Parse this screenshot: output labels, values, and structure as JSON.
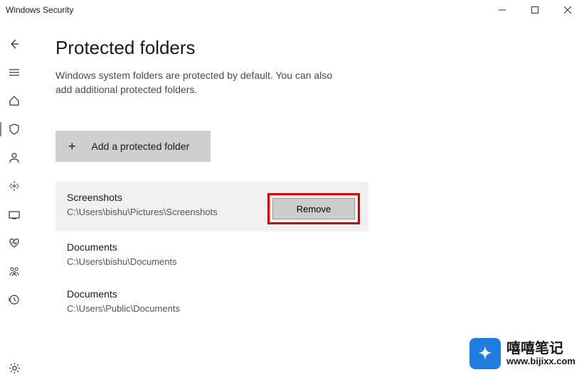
{
  "window": {
    "title": "Windows Security"
  },
  "page": {
    "title": "Protected folders",
    "description": "Windows system folders are protected by default. You can also add additional protected folders.",
    "add_button_label": "Add a protected folder"
  },
  "folders": [
    {
      "name": "Screenshots",
      "path": "C:\\Users\\bishu\\Pictures\\Screenshots",
      "expanded": true
    },
    {
      "name": "Documents",
      "path": "C:\\Users\\bishu\\Documents",
      "expanded": false
    },
    {
      "name": "Documents",
      "path": "C:\\Users\\Public\\Documents",
      "expanded": false
    }
  ],
  "actions": {
    "remove_label": "Remove"
  },
  "watermark": {
    "title": "嘻嘻笔记",
    "url": "www.bijixx.com"
  }
}
